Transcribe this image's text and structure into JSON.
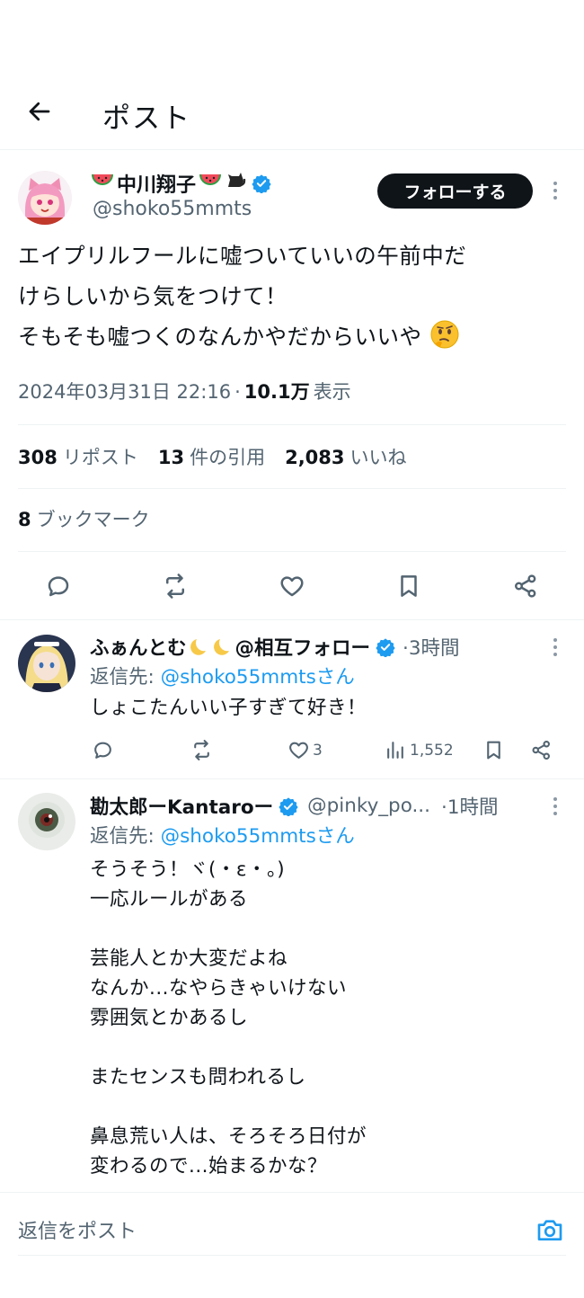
{
  "header": {
    "title": "ポスト"
  },
  "post": {
    "author_name": "中川翔子",
    "handle": "@shoko55mmts",
    "follow_label": "フォローする",
    "text_lines": [
      "エイプリルフールに嘘ついていいの午前中だ",
      "けらしいから気をつけて！",
      "そもそも嘘つくのなんかやだからいいや"
    ],
    "timestamp": "2024年03月31日 22:16",
    "sep": "·",
    "views": "10.1万",
    "views_label": "表示",
    "reposts": "308",
    "reposts_label": "リポスト",
    "quotes": "13",
    "quotes_label": "件の引用",
    "likes": "2,083",
    "likes_label": "いいね",
    "bookmarks": "8",
    "bookmarks_label": "ブックマーク"
  },
  "replies": [
    {
      "name": "ふぁんとむ",
      "name_suffix": "@相互フォロー",
      "time": "·3時間",
      "reply_prefix": "返信先: ",
      "reply_to": "@shoko55mmtsさん",
      "body_line": "しょこたんいい子すぎて好き！",
      "likes": "3",
      "views": "1,552"
    },
    {
      "name": "勘太郎ーKantaroー",
      "handle": "@pinky_po...",
      "time": "·1時間",
      "reply_prefix": "返信先: ",
      "reply_to": "@shoko55mmtsさん",
      "body_lines": [
        "そうそう！ヾ(・ε・。)",
        "一応ルールがある",
        "",
        "芸能人とか大変だよね",
        "なんか...なやらきゃいけない",
        "雰囲気とかあるし",
        "",
        "またセンスも問われるし",
        "",
        "鼻息荒い人は、そろそろ日付が",
        "変わるので...始まるかな？"
      ]
    }
  ],
  "composer": {
    "placeholder": "返信をポスト"
  },
  "colors": {
    "accent": "#1d9bf0",
    "text": "#0f1419",
    "muted": "#536471",
    "divider": "#eff3f4"
  },
  "icons": [
    "back-arrow-icon",
    "verified-badge-icon",
    "watermelon-icon",
    "black-cat-icon",
    "reply-icon",
    "repost-icon",
    "like-icon",
    "bookmark-icon",
    "share-icon",
    "views-icon",
    "camera-icon",
    "more-icon",
    "moon-icon",
    "thinking-face-icon"
  ]
}
